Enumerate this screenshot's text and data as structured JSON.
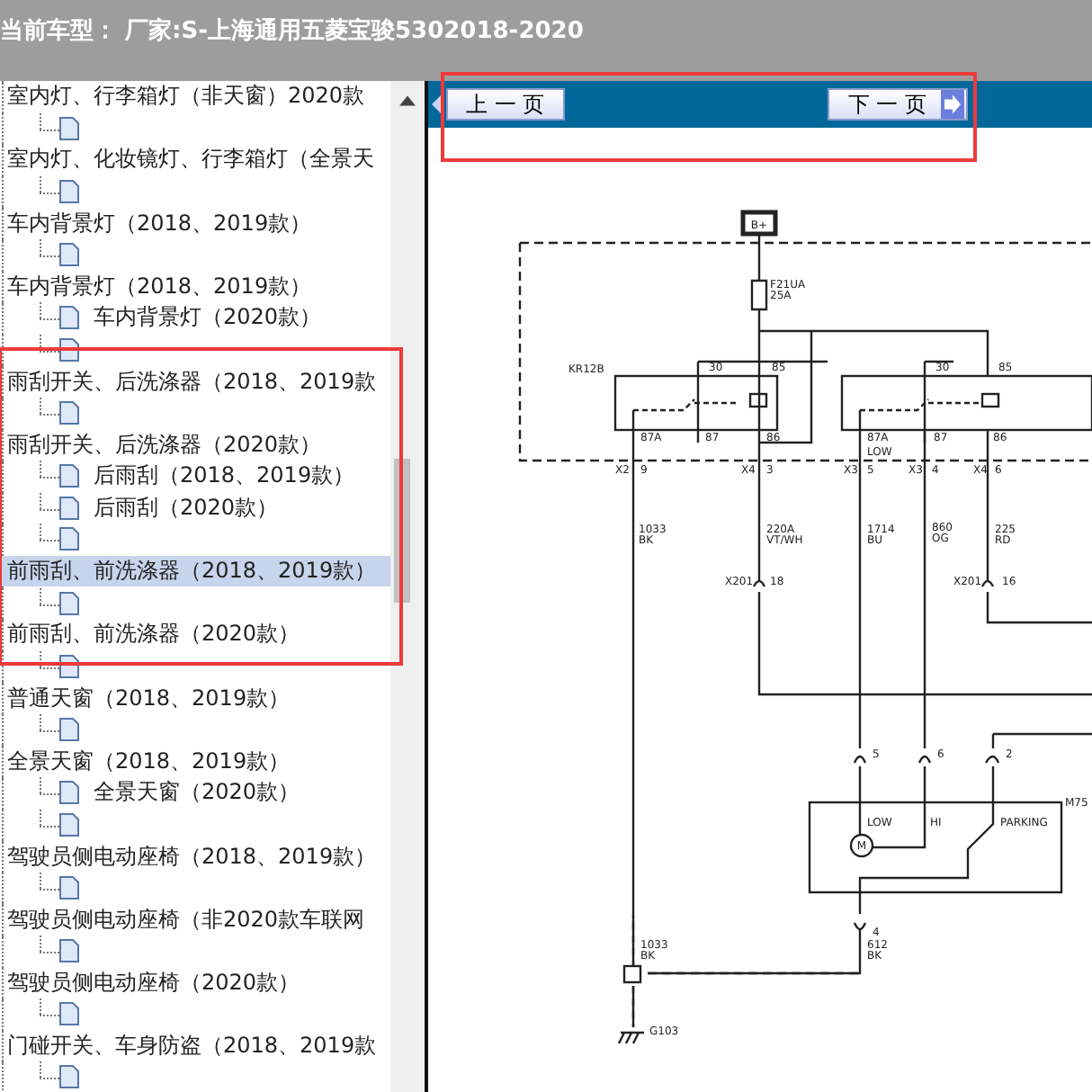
{
  "header": {
    "title": "当前车型：  厂家:S-上海通用五菱宝骏5302018-2020"
  },
  "tree": {
    "items": [
      {
        "label": "室内灯、行李箱灯（非天窗）2020款",
        "selected": false,
        "children": [
          {
            "kind": "page"
          }
        ]
      },
      {
        "label": "室内灯、化妆镜灯、行李箱灯（全景天",
        "selected": false,
        "children": [
          {
            "kind": "page"
          }
        ]
      },
      {
        "label": "车内背景灯（2018、2019款）",
        "selected": false,
        "children": [
          {
            "kind": "page"
          }
        ]
      },
      {
        "label": "车内背景灯（2018、2019款）",
        "selected": false,
        "children": [
          {
            "kind": "page",
            "label": "车内背景灯（2020款）"
          },
          {
            "kind": "page"
          }
        ]
      },
      {
        "label": "雨刮开关、后洗涤器（2018、2019款",
        "selected": false,
        "children": [
          {
            "kind": "page"
          }
        ]
      },
      {
        "label": "雨刮开关、后洗涤器（2020款）",
        "selected": false,
        "children": [
          {
            "kind": "page",
            "label": "后雨刮（2018、2019款）"
          },
          {
            "kind": "page",
            "label": "后雨刮（2020款）"
          },
          {
            "kind": "page"
          }
        ]
      },
      {
        "label": "前雨刮、前洗涤器（2018、2019款）",
        "selected": true,
        "children": [
          {
            "kind": "page"
          }
        ]
      },
      {
        "label": "前雨刮、前洗涤器（2020款）",
        "selected": false,
        "children": [
          {
            "kind": "page"
          }
        ]
      },
      {
        "label": "普通天窗（2018、2019款）",
        "selected": false,
        "children": [
          {
            "kind": "page"
          }
        ]
      },
      {
        "label": "全景天窗（2018、2019款）",
        "selected": false,
        "children": [
          {
            "kind": "page",
            "label": "全景天窗（2020款）"
          },
          {
            "kind": "page"
          }
        ]
      },
      {
        "label": "驾驶员侧电动座椅（2018、2019款）",
        "selected": false,
        "children": [
          {
            "kind": "page"
          }
        ]
      },
      {
        "label": "驾驶员侧电动座椅（非2020款车联网",
        "selected": false,
        "children": [
          {
            "kind": "page"
          }
        ]
      },
      {
        "label": "驾驶员侧电动座椅（2020款）",
        "selected": false,
        "children": [
          {
            "kind": "page"
          }
        ]
      },
      {
        "label": "门碰开关、车身防盗（2018、2019款",
        "selected": false,
        "children": [
          {
            "kind": "page"
          }
        ]
      }
    ]
  },
  "nav": {
    "prev": "上 一 页",
    "next": "下 一 页"
  },
  "diagram": {
    "labels": [
      "B+",
      "F21UA",
      "25A",
      "KR12B",
      "30",
      "85",
      "30",
      "85",
      "87A",
      "87",
      "86",
      "87A",
      "LOW",
      "87",
      "86",
      "X2",
      "9",
      "X4",
      "3",
      "X3",
      "5",
      "X3",
      "4",
      "X4",
      "6",
      "1033",
      "BK",
      "220A",
      "VT/WH",
      "1714",
      "BU",
      "860",
      "OG",
      "225",
      "RD",
      "X201",
      "18",
      "X201",
      "16",
      "5",
      "6",
      "2",
      "LOW",
      "HI",
      "PARKING",
      "M75",
      "M",
      "4",
      "612",
      "BK",
      "1033",
      "BK",
      "G103"
    ]
  }
}
